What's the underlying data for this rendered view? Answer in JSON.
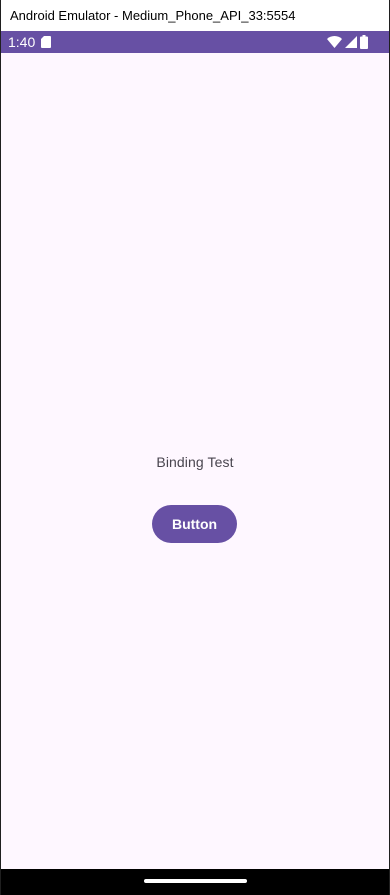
{
  "window": {
    "title": "Android Emulator - Medium_Phone_API_33:5554"
  },
  "status_bar": {
    "time": "1:40",
    "background_color": "#6750a4",
    "icons": [
      "sd-card-icon",
      "wifi-icon",
      "cell-signal-icon",
      "battery-icon"
    ]
  },
  "app": {
    "background_color": "#fef7ff",
    "text": "Binding Test",
    "button_label": "Button",
    "button_color": "#6750a4"
  },
  "nav_bar": {
    "type": "gesture-handle"
  }
}
